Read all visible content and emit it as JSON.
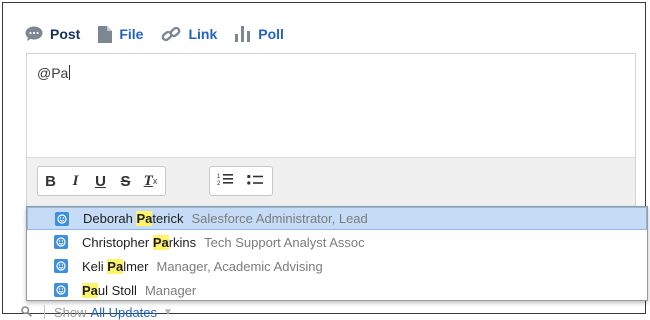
{
  "tabs": [
    {
      "label": "Post",
      "icon": "chat-bubble-icon",
      "active": true
    },
    {
      "label": "File",
      "icon": "file-icon",
      "active": false
    },
    {
      "label": "Link",
      "icon": "link-icon",
      "active": false
    },
    {
      "label": "Poll",
      "icon": "bar-chart-icon",
      "active": false
    }
  ],
  "composer": {
    "text": "@Pa"
  },
  "toolbar": {
    "bold": "B",
    "italic": "I",
    "underline": "U",
    "strike": "S",
    "clear": "T",
    "clear_sub": "x"
  },
  "mention_suggestions": [
    {
      "pre": "Deborah ",
      "match": "Pa",
      "post": "terick",
      "title": "Salesforce Administrator, Lead"
    },
    {
      "pre": "Christopher ",
      "match": "Pa",
      "post": "rkins",
      "title": "Tech Support Analyst Assoc"
    },
    {
      "pre": "Keli ",
      "match": "Pa",
      "post": "lmer",
      "title": "Manager, Academic Advising"
    },
    {
      "pre": "",
      "match": "Pa",
      "post": "ul Stoll",
      "title": "Manager"
    }
  ],
  "footer": {
    "show": "Show",
    "filter": "All Updates"
  },
  "colors": {
    "link_blue": "#1f63c7",
    "highlight": "#fff36a",
    "selected_row": "#c6dcf6",
    "avatar": "#3d8fe0"
  }
}
